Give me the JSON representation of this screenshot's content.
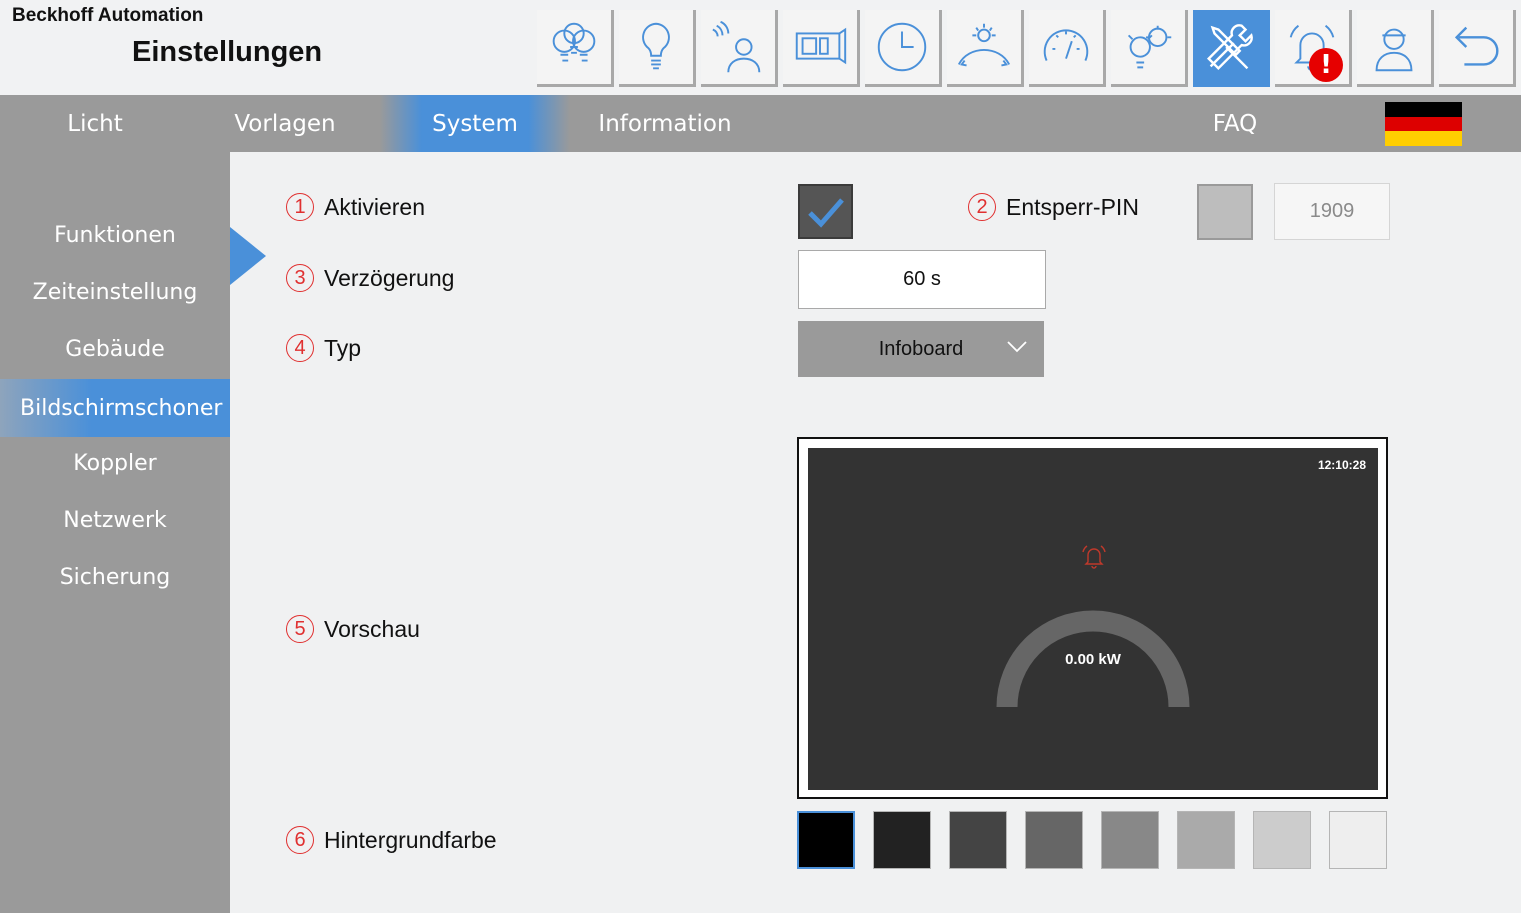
{
  "header": {
    "brand": "Beckhoff Automation",
    "title": "Einstellungen",
    "toolbar": [
      {
        "icon": "bulb-group-icon"
      },
      {
        "icon": "bulb-icon"
      },
      {
        "icon": "presence-sensor-icon"
      },
      {
        "icon": "blind-icon"
      },
      {
        "icon": "clock-icon"
      },
      {
        "icon": "sun-position-icon"
      },
      {
        "icon": "gauge-icon"
      },
      {
        "icon": "automation-gears-icon"
      },
      {
        "icon": "settings-tools-icon",
        "active": true
      },
      {
        "icon": "alarm-bell-icon",
        "badge": "!"
      },
      {
        "icon": "user-icon"
      },
      {
        "icon": "back-icon"
      }
    ]
  },
  "nav": {
    "tabs": [
      "Licht",
      "Vorlagen",
      "System",
      "Information",
      "FAQ"
    ],
    "active": "System",
    "language": "de"
  },
  "sidebar": {
    "items": [
      "Funktionen",
      "Zeiteinstellung",
      "Gebäude",
      "Bildschirmschoner",
      "Koppler",
      "Netzwerk",
      "Sicherung"
    ],
    "active": "Bildschirmschoner"
  },
  "form": {
    "activate": {
      "num": "1",
      "label": "Aktivieren",
      "checked": true
    },
    "pin": {
      "num": "2",
      "label": "Entsperr-PIN",
      "checked": false,
      "value": "1909"
    },
    "delay": {
      "num": "3",
      "label": "Verzögerung",
      "value": "60 s"
    },
    "type": {
      "num": "4",
      "label": "Typ",
      "value": "Infoboard"
    },
    "preview": {
      "num": "5",
      "label": "Vorschau",
      "time": "12:10:28",
      "power": "0.00 kW"
    },
    "background": {
      "num": "6",
      "label": "Hintergrundfarbe",
      "colors": [
        "#000000",
        "#222222",
        "#444444",
        "#666666",
        "#888888",
        "#aaaaaa",
        "#cccccc",
        "#eeeeee"
      ],
      "selected": 0
    }
  },
  "colors": {
    "accent": "#4a90d9",
    "alert": "#e60000",
    "number": "#e03030"
  }
}
